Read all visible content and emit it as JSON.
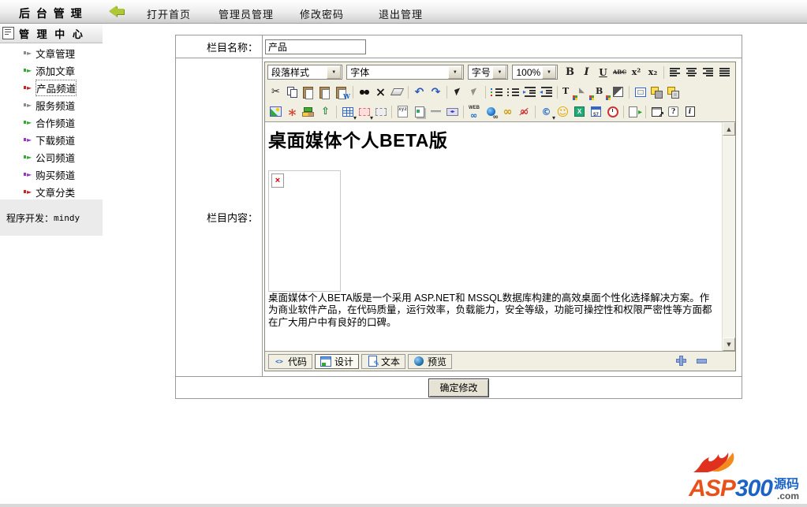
{
  "topbar": {
    "title": "后 台 管 理",
    "menu": [
      {
        "label": "打开首页"
      },
      {
        "label": "管理员管理"
      },
      {
        "label": "修改密码"
      },
      {
        "label": "退出管理"
      }
    ],
    "back_arrow_icon": "green-back-arrow"
  },
  "sidebar": {
    "header": "管 理 中 心",
    "items": [
      {
        "label": "文章管理",
        "arrow_color": "#8a8a8a"
      },
      {
        "label": "添加文章",
        "arrow_color": "#33aa33"
      },
      {
        "label": "产品频道",
        "arrow_color": "#cc2222",
        "active": true
      },
      {
        "label": "服务频道",
        "arrow_color": "#8a8a8a"
      },
      {
        "label": "合作频道",
        "arrow_color": "#33aa33"
      },
      {
        "label": "下载频道",
        "arrow_color": "#9933cc"
      },
      {
        "label": "公司频道",
        "arrow_color": "#33aa33"
      },
      {
        "label": "购买频道",
        "arrow_color": "#9933cc"
      },
      {
        "label": "文章分类",
        "arrow_color": "#cc2222"
      }
    ],
    "footer_label": "程序开发：",
    "footer_value": "mindy"
  },
  "form": {
    "name_label": "栏目名称：",
    "name_value": "产品",
    "content_label": "栏目内容：",
    "submit_label": "确定修改"
  },
  "editor": {
    "style_select": "段落样式",
    "font_select": "字体",
    "size_select": "字号",
    "zoom_select": "100%",
    "toolbar_row1_icons": [
      "bold",
      "italic",
      "underline",
      "strikethrough",
      "superscript",
      "subscript",
      "align-left",
      "align-center",
      "align-right",
      "align-justify"
    ],
    "toolbar_row2_icons": [
      "cut",
      "copy",
      "paste",
      "paste-text",
      "paste-word",
      "find",
      "delete",
      "eraser",
      "undo",
      "redo",
      "select",
      "select-all",
      "ordered-list",
      "unordered-list",
      "indent",
      "outdent",
      "font-color",
      "fill-color",
      "background-color",
      "contrast",
      "border-box",
      "bring-to-front",
      "send-to-back"
    ],
    "toolbar_row3_icons": [
      "insert-image",
      "insert-flash",
      "insert-media",
      "upload",
      "insert-table",
      "red-layer",
      "gray-layer",
      "custom-tag",
      "insert-document",
      "horizontal-rule",
      "marquee",
      "web-link",
      "hyperlink",
      "anchor-link",
      "unlink",
      "copyright",
      "emoticon",
      "insert-excel",
      "insert-calendar",
      "insert-clock",
      "export-document",
      "new-window",
      "help",
      "info"
    ],
    "content": {
      "heading": "桌面媒体个人BETA版",
      "body": "桌面媒体个人BETA版是一个采用 ASP.NET和 MSSQL数据库构建的高效桌面个性化选择解决方案。作为商业软件产品，在代码质量，运行效率，负载能力，安全等级，功能可操控性和权限严密性等方面都在广大用户中有良好的口碑。",
      "broken_image": "broken-image-placeholder"
    },
    "tabs": [
      {
        "label": "代码"
      },
      {
        "label": "设计",
        "active": true
      },
      {
        "label": "文本"
      },
      {
        "label": "预览"
      }
    ]
  },
  "logo": {
    "asp": "ASP",
    "three_hundred": "300",
    "yuanma": "源码",
    "com": ".com"
  },
  "colors": {
    "toolbar_bg": "#f1efe2",
    "panel_border": "#9a9a9a",
    "logo_orange": "#e8521a",
    "logo_blue": "#1b63c5",
    "back_arrow_green": "#aec838"
  }
}
